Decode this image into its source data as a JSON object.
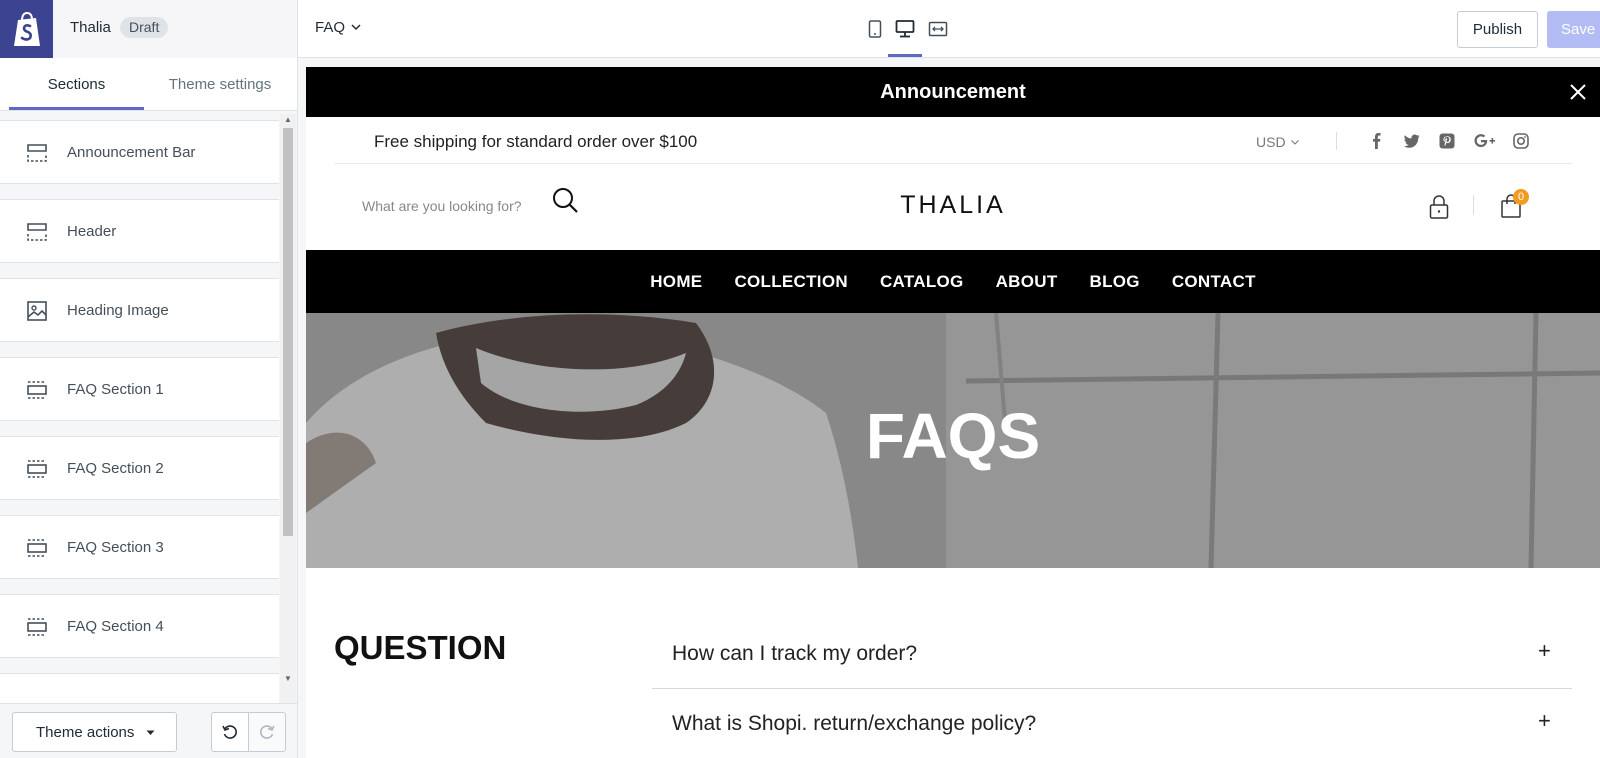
{
  "topbar": {
    "store_name": "Thalia",
    "status_badge": "Draft",
    "page_selector": "FAQ",
    "publish_label": "Publish",
    "save_label": "Save"
  },
  "sidebar": {
    "tabs": [
      {
        "label": "Sections",
        "active": true
      },
      {
        "label": "Theme settings",
        "active": false
      }
    ],
    "sections": [
      {
        "label": "Announcement Bar",
        "icon": "header-section-icon"
      },
      {
        "label": "Header",
        "icon": "header-section-icon"
      },
      {
        "label": "Heading Image",
        "icon": "image-icon"
      },
      {
        "label": "FAQ Section 1",
        "icon": "section-icon"
      },
      {
        "label": "FAQ Section 2",
        "icon": "section-icon"
      },
      {
        "label": "FAQ Section 3",
        "icon": "section-icon"
      },
      {
        "label": "FAQ Section 4",
        "icon": "section-icon"
      }
    ],
    "theme_actions_label": "Theme actions"
  },
  "preview": {
    "announcement": "Announcement",
    "shipping_text": "Free shipping for standard order over $100",
    "currency": "USD",
    "social_icons": [
      "facebook-icon",
      "twitter-icon",
      "pinterest-icon",
      "google-plus-icon",
      "instagram-icon"
    ],
    "search_placeholder": "What are you looking for?",
    "brand": "THALIA",
    "cart_count": "0",
    "nav": [
      "HOME",
      "COLLECTION",
      "CATALOG",
      "ABOUT",
      "BLOG",
      "CONTACT"
    ],
    "hero_title": "FAQS",
    "question_heading": "QUESTION",
    "faqs": [
      {
        "question": "How can I track my order?",
        "toggle": "+"
      },
      {
        "question": "What is Shopi. return/exchange policy?",
        "toggle": "+"
      }
    ]
  },
  "colors": {
    "accent": "#5c6ac4",
    "logo_bg": "#3c4390",
    "save_disabled": "#b3bcf5",
    "cart_badge": "#f29c1f"
  }
}
